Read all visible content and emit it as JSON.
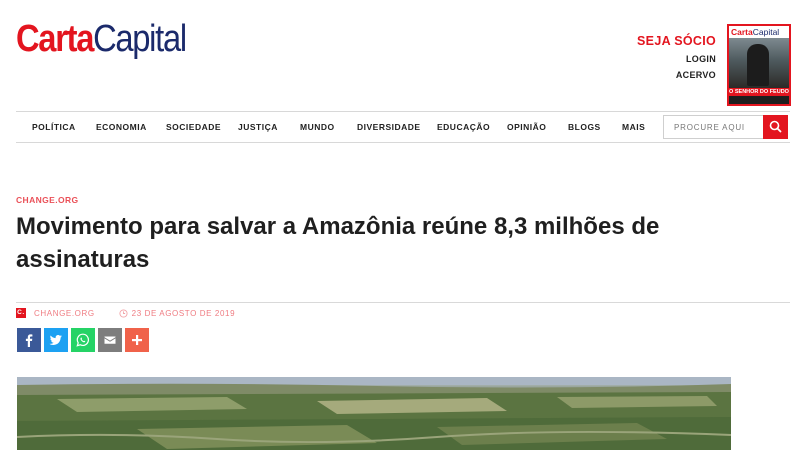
{
  "header": {
    "logo_carta": "Carta",
    "logo_capital": "Capital",
    "seja_socio": "SEJA SÓCIO",
    "login": "LOGIN",
    "acervo": "ACERVO"
  },
  "cover": {
    "title_red": "Carta",
    "title_blue": "Capital",
    "headline": "O SENHOR DO FEUDO"
  },
  "nav": {
    "items": [
      "POLÍTICA",
      "ECONOMIA",
      "SOCIEDADE",
      "JUSTIÇA",
      "MUNDO",
      "DIVERSIDADE",
      "EDUCAÇÃO",
      "OPINIÃO",
      "BLOGS",
      "MAIS"
    ],
    "search_placeholder": "PROCURE AQUI"
  },
  "article": {
    "kicker": "CHANGE.ORG",
    "headline": "Movimento para salvar a Amazônia reúne 8,3 milhões de assinaturas",
    "author_badge": "C.",
    "author": "CHANGE.ORG",
    "date": "23 DE AGOSTO DE 2019"
  },
  "share": [
    {
      "icon": "facebook-icon",
      "color": "#3b5998"
    },
    {
      "icon": "twitter-icon",
      "color": "#1da1f2"
    },
    {
      "icon": "whatsapp-icon",
      "color": "#25d366"
    },
    {
      "icon": "email-icon",
      "color": "#7d7d7d"
    },
    {
      "icon": "plus-icon",
      "color": "#f0624a"
    }
  ],
  "colors": {
    "brand_red": "#e3151f",
    "brand_blue": "#1b2a6b"
  }
}
